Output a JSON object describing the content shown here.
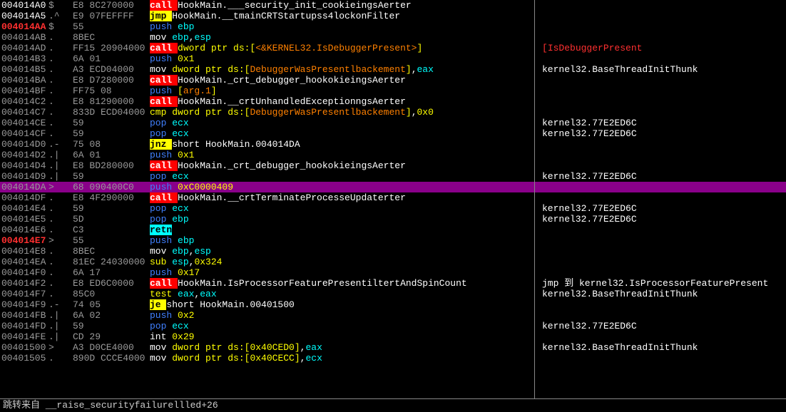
{
  "rows": [
    {
      "a": "004014A0",
      "ac": "w",
      "m": "$",
      "b": "E8 8C270000",
      "i": [
        {
          "t": "call ",
          "c": "op-call"
        },
        {
          "t": "HookMain.___security_init_cookieingsAerter",
          "c": "w"
        }
      ],
      "r": ""
    },
    {
      "a": "004014A5",
      "ac": "w",
      "m": ".^",
      "b": "E9 07FEFFFF",
      "i": [
        {
          "t": "jmp ",
          "c": "op-jmp"
        },
        {
          "t": "HookMain.__tmainCRTStartupss4lockonFilter",
          "c": "w"
        }
      ],
      "r": ""
    },
    {
      "a": "004014AA",
      "ac": "r",
      "m": "$",
      "b": "55",
      "i": [
        {
          "t": "push ",
          "c": "bl"
        },
        {
          "t": "ebp",
          "c": "cy"
        }
      ],
      "r": ""
    },
    {
      "a": "004014AB",
      "ac": "d",
      "m": ".",
      "b": "8BEC",
      "i": [
        {
          "t": "mov ",
          "c": "w"
        },
        {
          "t": "ebp",
          "c": "cy"
        },
        {
          "t": ",",
          "c": "w"
        },
        {
          "t": "esp",
          "c": "cy"
        }
      ],
      "r": ""
    },
    {
      "a": "004014AD",
      "ac": "d",
      "m": ".",
      "b": "FF15 20904000",
      "i": [
        {
          "t": "call ",
          "c": "op-call"
        },
        {
          "t": "dword ptr ds:[",
          "c": "ye"
        },
        {
          "t": "<&KERNEL32.IsDebuggerPresent>",
          "c": "or"
        },
        {
          "t": "]",
          "c": "ye"
        }
      ],
      "r": "IsDebuggerPresent",
      "rc": "rd",
      "cur": true
    },
    {
      "a": "004014B3",
      "ac": "d",
      "m": ".",
      "b": "6A 01",
      "i": [
        {
          "t": "push ",
          "c": "bl"
        },
        {
          "t": "0x1",
          "c": "ye"
        }
      ],
      "r": ""
    },
    {
      "a": "004014B5",
      "ac": "d",
      "m": ".",
      "b": "A3 ECD04000",
      "i": [
        {
          "t": "mov ",
          "c": "w"
        },
        {
          "t": "dword ptr ds:[",
          "c": "ye"
        },
        {
          "t": "DebuggerWasPresentlbackement",
          "c": "or"
        },
        {
          "t": "]",
          "c": "ye"
        },
        {
          "t": ",",
          "c": "w"
        },
        {
          "t": "eax",
          "c": "cy"
        }
      ],
      "r": "kernel32.BaseThreadInitThunk",
      "rc": "w"
    },
    {
      "a": "004014BA",
      "ac": "d",
      "m": ".",
      "b": "E8 D7280000",
      "i": [
        {
          "t": "call ",
          "c": "op-call"
        },
        {
          "t": "HookMain._crt_debugger_hookokieingsAerter",
          "c": "w"
        }
      ],
      "r": ""
    },
    {
      "a": "004014BF",
      "ac": "d",
      "m": ".",
      "b": "FF75 08",
      "i": [
        {
          "t": "push ",
          "c": "bl"
        },
        {
          "t": "[",
          "c": "ye"
        },
        {
          "t": "arg.1",
          "c": "or"
        },
        {
          "t": "]",
          "c": "ye"
        }
      ],
      "r": ""
    },
    {
      "a": "004014C2",
      "ac": "d",
      "m": ".",
      "b": "E8 81290000",
      "i": [
        {
          "t": "call ",
          "c": "op-call"
        },
        {
          "t": "HookMain.__crtUnhandledExceptionngsAerter",
          "c": "w"
        }
      ],
      "r": ""
    },
    {
      "a": "004014C7",
      "ac": "d",
      "m": ".",
      "b": "833D ECD04000",
      "i": [
        {
          "t": "cmp ",
          "c": "ye"
        },
        {
          "t": "dword ptr ds:[",
          "c": "ye"
        },
        {
          "t": "DebuggerWasPresentlbackement",
          "c": "or"
        },
        {
          "t": "]",
          "c": "ye"
        },
        {
          "t": ",",
          "c": "w"
        },
        {
          "t": "0x0",
          "c": "ye"
        }
      ],
      "r": ""
    },
    {
      "a": "004014CE",
      "ac": "d",
      "m": ".",
      "b": "59",
      "i": [
        {
          "t": "pop ",
          "c": "bl"
        },
        {
          "t": "ecx",
          "c": "cy"
        }
      ],
      "r": "kernel32.77E2ED6C",
      "rc": "w"
    },
    {
      "a": "004014CF",
      "ac": "d",
      "m": ".",
      "b": "59",
      "i": [
        {
          "t": "pop ",
          "c": "bl"
        },
        {
          "t": "ecx",
          "c": "cy"
        }
      ],
      "r": "kernel32.77E2ED6C",
      "rc": "w"
    },
    {
      "a": "004014D0",
      "ac": "d",
      "m": ".-",
      "b": "75 08",
      "i": [
        {
          "t": "jnz ",
          "c": "op-jmp"
        },
        {
          "t": "short HookMain.004014DA",
          "c": "w"
        }
      ],
      "r": ""
    },
    {
      "a": "004014D2",
      "ac": "d",
      "m": ".|",
      "b": "6A 01",
      "i": [
        {
          "t": "push ",
          "c": "bl"
        },
        {
          "t": "0x1",
          "c": "ye"
        }
      ],
      "r": ""
    },
    {
      "a": "004014D4",
      "ac": "d",
      "m": ".|",
      "b": "E8 BD280000",
      "i": [
        {
          "t": "call ",
          "c": "op-call"
        },
        {
          "t": "HookMain._crt_debugger_hookokieingsAerter",
          "c": "w"
        }
      ],
      "r": ""
    },
    {
      "a": "004014D9",
      "ac": "d",
      "m": ".|",
      "b": "59",
      "i": [
        {
          "t": "pop ",
          "c": "bl"
        },
        {
          "t": "ecx",
          "c": "cy"
        }
      ],
      "r": "kernel32.77E2ED6C",
      "rc": "w"
    },
    {
      "a": "004014DA",
      "ac": "d",
      "m": ">",
      "b": "68 090400C0",
      "i": [
        {
          "t": "push ",
          "c": "bl"
        },
        {
          "t": "0xC0000409",
          "c": "ye"
        }
      ],
      "r": "",
      "hl": true
    },
    {
      "a": "004014DF",
      "ac": "d",
      "m": ".",
      "b": "E8 4F290000",
      "i": [
        {
          "t": "call ",
          "c": "op-call"
        },
        {
          "t": "HookMain.__crtTerminateProcesseUpdaterter",
          "c": "w"
        }
      ],
      "r": ""
    },
    {
      "a": "004014E4",
      "ac": "d",
      "m": ".",
      "b": "59",
      "i": [
        {
          "t": "pop ",
          "c": "bl"
        },
        {
          "t": "ecx",
          "c": "cy"
        }
      ],
      "r": "kernel32.77E2ED6C",
      "rc": "w"
    },
    {
      "a": "004014E5",
      "ac": "d",
      "m": ".",
      "b": "5D",
      "i": [
        {
          "t": "pop ",
          "c": "bl"
        },
        {
          "t": "ebp",
          "c": "cy"
        }
      ],
      "r": "kernel32.77E2ED6C",
      "rc": "w"
    },
    {
      "a": "004014E6",
      "ac": "d",
      "m": ".",
      "b": "C3",
      "i": [
        {
          "t": "retn",
          "c": "op-retn"
        }
      ],
      "r": ""
    },
    {
      "a": "004014E7",
      "ac": "r",
      "m": ">",
      "b": "55",
      "i": [
        {
          "t": "push ",
          "c": "bl"
        },
        {
          "t": "ebp",
          "c": "cy"
        }
      ],
      "r": ""
    },
    {
      "a": "004014E8",
      "ac": "d",
      "m": ".",
      "b": "8BEC",
      "i": [
        {
          "t": "mov ",
          "c": "w"
        },
        {
          "t": "ebp",
          "c": "cy"
        },
        {
          "t": ",",
          "c": "w"
        },
        {
          "t": "esp",
          "c": "cy"
        }
      ],
      "r": ""
    },
    {
      "a": "004014EA",
      "ac": "d",
      "m": ".",
      "b": "81EC 24030000",
      "i": [
        {
          "t": "sub ",
          "c": "ye"
        },
        {
          "t": "esp",
          "c": "cy"
        },
        {
          "t": ",",
          "c": "w"
        },
        {
          "t": "0x324",
          "c": "ye"
        }
      ],
      "r": ""
    },
    {
      "a": "004014F0",
      "ac": "d",
      "m": ".",
      "b": "6A 17",
      "i": [
        {
          "t": "push ",
          "c": "bl"
        },
        {
          "t": "0x17",
          "c": "ye"
        }
      ],
      "r": ""
    },
    {
      "a": "004014F2",
      "ac": "d",
      "m": ".",
      "b": "E8 ED6C0000",
      "i": [
        {
          "t": "call ",
          "c": "op-call"
        },
        {
          "t": "HookMain.IsProcessorFeaturePresentiltertAndSpinCount",
          "c": "w"
        }
      ],
      "r": "jmp 到 kernel32.IsProcessorFeaturePresent",
      "rc": "w"
    },
    {
      "a": "004014F7",
      "ac": "d",
      "m": ".",
      "b": "85C0",
      "i": [
        {
          "t": "test ",
          "c": "ye"
        },
        {
          "t": "eax",
          "c": "cy"
        },
        {
          "t": ",",
          "c": "w"
        },
        {
          "t": "eax",
          "c": "cy"
        }
      ],
      "r": "kernel32.BaseThreadInitThunk",
      "rc": "w"
    },
    {
      "a": "004014F9",
      "ac": "d",
      "m": ".-",
      "b": "74 05",
      "i": [
        {
          "t": "je ",
          "c": "op-jmp"
        },
        {
          "t": "short HookMain.00401500",
          "c": "w"
        }
      ],
      "r": ""
    },
    {
      "a": "004014FB",
      "ac": "d",
      "m": ".|",
      "b": "6A 02",
      "i": [
        {
          "t": "push ",
          "c": "bl"
        },
        {
          "t": "0x2",
          "c": "ye"
        }
      ],
      "r": ""
    },
    {
      "a": "004014FD",
      "ac": "d",
      "m": ".|",
      "b": "59",
      "i": [
        {
          "t": "pop ",
          "c": "bl"
        },
        {
          "t": "ecx",
          "c": "cy"
        }
      ],
      "r": "kernel32.77E2ED6C",
      "rc": "w"
    },
    {
      "a": "004014FE",
      "ac": "d",
      "m": ".|",
      "b": "CD 29",
      "i": [
        {
          "t": "int ",
          "c": "w"
        },
        {
          "t": "0x29",
          "c": "ye"
        }
      ],
      "r": ""
    },
    {
      "a": "00401500",
      "ac": "d",
      "m": ">",
      "b": "A3 D0CE4000",
      "i": [
        {
          "t": "mov ",
          "c": "w"
        },
        {
          "t": "dword ptr ds:[",
          "c": "ye"
        },
        {
          "t": "0x40CED0",
          "c": "ye"
        },
        {
          "t": "]",
          "c": "ye"
        },
        {
          "t": ",",
          "c": "w"
        },
        {
          "t": "eax",
          "c": "cy"
        }
      ],
      "r": "kernel32.BaseThreadInitThunk",
      "rc": "w"
    },
    {
      "a": "00401505",
      "ac": "d",
      "m": ".",
      "b": "890D CCCE4000",
      "i": [
        {
          "t": "mov ",
          "c": "w"
        },
        {
          "t": "dword ptr ds:[",
          "c": "ye"
        },
        {
          "t": "0x40CECC",
          "c": "ye"
        },
        {
          "t": "]",
          "c": "ye"
        },
        {
          "t": ",",
          "c": "w"
        },
        {
          "t": "ecx",
          "c": "cy"
        }
      ],
      "r": ""
    }
  ],
  "status": "跳转来自 __raise_securityfailurellled+26"
}
